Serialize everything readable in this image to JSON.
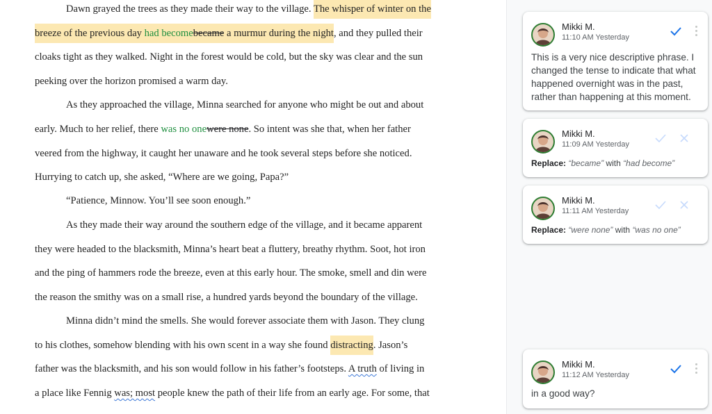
{
  "document": {
    "lines": [
      {
        "segments": [
          {
            "text": "Dawn grayed the trees as they made their way to the village. "
          },
          {
            "text": "The whisper of winter on the",
            "style": "hl"
          }
        ]
      },
      {
        "segments": [
          {
            "text": "breeze of the previous day ",
            "style": "hl"
          },
          {
            "text": "had become",
            "style": "hl-ins"
          },
          {
            "text": "became",
            "style": "hl-del"
          },
          {
            "text": " a murmur during the night",
            "style": "hl"
          },
          {
            "text": ", and they pulled their"
          }
        ]
      },
      {
        "segments": [
          {
            "text": "cloaks tight as they walked. Night in the forest would be cold, but the sky was clear and the sun"
          }
        ]
      },
      {
        "segments": [
          {
            "text": "peeking over the horizon promised a warm day."
          }
        ]
      },
      {
        "segments": [
          {
            "text": "As they approached the village, Minna searched for anyone who might be out and about"
          }
        ]
      },
      {
        "segments": [
          {
            "text": "early. Much to her relief, there "
          },
          {
            "text": "was no one",
            "style": "ins"
          },
          {
            "text": "were none",
            "style": "del"
          },
          {
            "text": ". So intent was she that, when her father"
          }
        ]
      },
      {
        "segments": [
          {
            "text": "veered from the highway, it caught her unaware and he took several steps before she noticed."
          }
        ]
      },
      {
        "segments": [
          {
            "text": "Hurrying to catch up, she asked, “Where are we going, Papa?”"
          }
        ]
      },
      {
        "segments": [
          {
            "text": "“Patience, Minnow. You’ll see soon enough.”"
          }
        ]
      },
      {
        "segments": [
          {
            "text": "As they made their way around the southern edge of the village, and it became apparent"
          }
        ]
      },
      {
        "segments": [
          {
            "text": "they were headed to the blacksmith, Minna’s heart beat a fluttery, breathy rhythm. Soot, hot iron"
          }
        ]
      },
      {
        "segments": [
          {
            "text": "and the ping of hammers rode the breeze, even at this early hour. The smoke, smell and din were"
          }
        ]
      },
      {
        "segments": [
          {
            "text": "the reason the smithy was on a small rise, a hundred yards beyond the boundary of the village."
          }
        ]
      },
      {
        "segments": [
          {
            "text": "Minna didn’t mind the smells. She would forever associate them with Jason. They clung"
          }
        ]
      },
      {
        "segments": [
          {
            "text": "to his clothes, somehow blending with his own scent in a way she found "
          },
          {
            "text": "distracting",
            "style": "hl"
          },
          {
            "text": ". Jason’s"
          }
        ]
      },
      {
        "segments": [
          {
            "text": "father was the blacksmith, and his son would follow in his father’s footsteps. "
          },
          {
            "text": "A truth",
            "style": "sq"
          },
          {
            "text": " of living in"
          }
        ]
      },
      {
        "segments": [
          {
            "text": "a place like Fennig "
          },
          {
            "text": "was; most",
            "style": "sq"
          },
          {
            "text": " people knew the path of their life from an early age. For some, that"
          }
        ]
      }
    ]
  },
  "comments": [
    {
      "author": "Mikki M.",
      "time": "11:10 AM Yesterday",
      "text": "This is a very nice descriptive phrase. I changed the tense to indicate that what happened overnight was in the past, rather than happening at this moment.",
      "resolve_icon": "checkmark-icon",
      "menu_icon": "more-vert-icon"
    },
    {
      "author": "Mikki M.",
      "time": "11:09 AM Yesterday",
      "replace_label": "Replace:",
      "old": "“became”",
      "with_word": "with",
      "new": "“had become”",
      "accept_icon": "checkmark-icon",
      "reject_icon": "close-icon"
    },
    {
      "author": "Mikki M.",
      "time": "11:11 AM Yesterday",
      "replace_label": "Replace:",
      "old": "“were none”",
      "with_word": "with",
      "new": "“was no one”",
      "accept_icon": "checkmark-icon",
      "reject_icon": "close-icon"
    },
    {
      "author": "Mikki M.",
      "time": "11:12 AM Yesterday",
      "text": "in a good way?",
      "resolve_icon": "checkmark-icon",
      "menu_icon": "more-vert-icon"
    }
  ],
  "colors": {
    "highlight": "#fce8b2",
    "insertion": "#1e8e3e",
    "accent": "#1a73e8",
    "panel_bg": "#f8f9fa"
  }
}
